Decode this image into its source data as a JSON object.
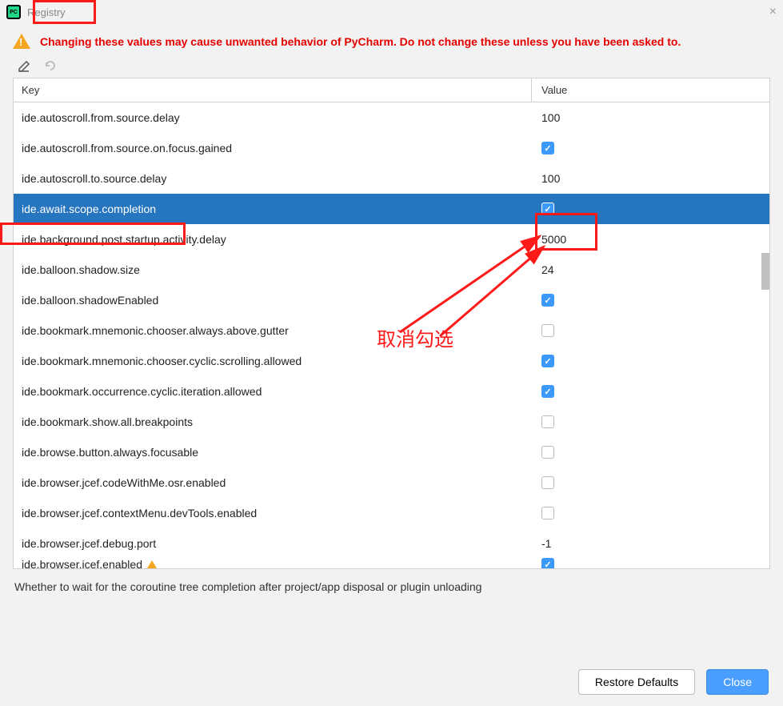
{
  "window": {
    "title": "Registry"
  },
  "warning": "Changing these values may cause unwanted behavior of PyCharm. Do not change these unless you have been asked to.",
  "columns": {
    "key": "Key",
    "value": "Value"
  },
  "rows": [
    {
      "key": "ide.autoscroll.from.source.delay",
      "type": "text",
      "value": "100"
    },
    {
      "key": "ide.autoscroll.from.source.on.focus.gained",
      "type": "check",
      "checked": true
    },
    {
      "key": "ide.autoscroll.to.source.delay",
      "type": "text",
      "value": "100"
    },
    {
      "key": "ide.await.scope.completion",
      "type": "check",
      "checked": true,
      "selected": true
    },
    {
      "key": "ide.background.post.startup.activity.delay",
      "type": "text",
      "value": "5000"
    },
    {
      "key": "ide.balloon.shadow.size",
      "type": "text",
      "value": "24"
    },
    {
      "key": "ide.balloon.shadowEnabled",
      "type": "check",
      "checked": true
    },
    {
      "key": "ide.bookmark.mnemonic.chooser.always.above.gutter",
      "type": "check",
      "checked": false
    },
    {
      "key": "ide.bookmark.mnemonic.chooser.cyclic.scrolling.allowed",
      "type": "check",
      "checked": true
    },
    {
      "key": "ide.bookmark.occurrence.cyclic.iteration.allowed",
      "type": "check",
      "checked": true
    },
    {
      "key": "ide.bookmark.show.all.breakpoints",
      "type": "check",
      "checked": false
    },
    {
      "key": "ide.browse.button.always.focusable",
      "type": "check",
      "checked": false
    },
    {
      "key": "ide.browser.jcef.codeWithMe.osr.enabled",
      "type": "check",
      "checked": false
    },
    {
      "key": "ide.browser.jcef.contextMenu.devTools.enabled",
      "type": "check",
      "checked": false
    },
    {
      "key": "ide.browser.jcef.debug.port",
      "type": "text",
      "value": "-1"
    },
    {
      "key": "ide.browser.jcef.enabled",
      "type": "check",
      "checked": true,
      "modified": true,
      "cutoff": true
    }
  ],
  "description": "Whether to wait for the coroutine tree completion after project/app disposal or plugin unloading",
  "buttons": {
    "restore": "Restore Defaults",
    "close": "Close"
  },
  "annotation": {
    "label": "取消勾选"
  }
}
